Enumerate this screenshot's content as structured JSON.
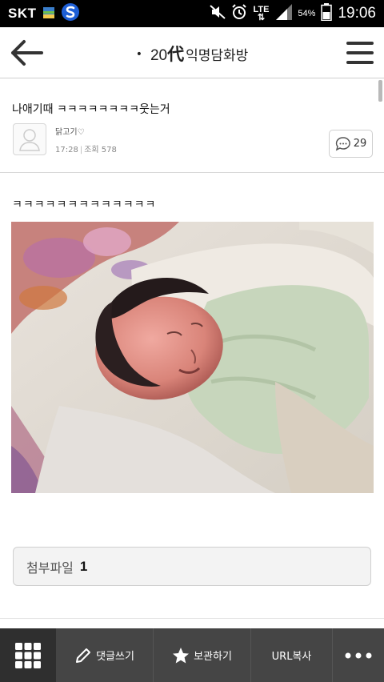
{
  "status_bar": {
    "carrier": "SKT",
    "lte": "LTE",
    "battery_percent": "54%",
    "time": "19:06"
  },
  "app_bar": {
    "title_number": "20",
    "title_kanji": "代",
    "title_text": "익명담화방"
  },
  "post": {
    "title": "나애기때 ㅋㅋㅋㅋㅋㅋㅋㅋ웃는거",
    "author": "닭고기♡",
    "time": "17:28",
    "views_label": "조회",
    "views": "578",
    "comment_count": "29",
    "body_text": "ㅋㅋㅋㅋㅋㅋㅋㅋㅋㅋㅋㅋㅋ"
  },
  "attachment": {
    "label": "첨부파일",
    "count": "1"
  },
  "toolbar": {
    "reply_label": "댓글쓰기",
    "save_label": "보관하기",
    "url_label": "URL복사"
  }
}
